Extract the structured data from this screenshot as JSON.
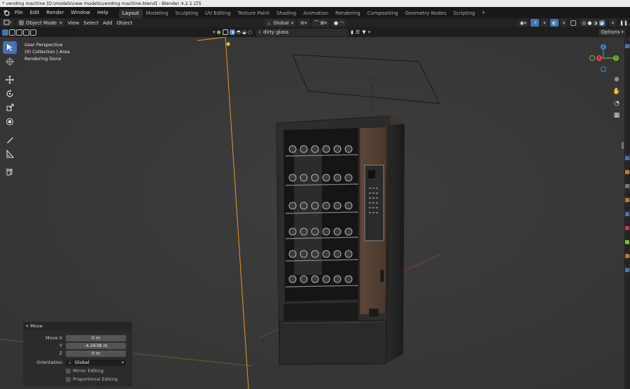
{
  "window": {
    "title": "* vending machine [D:\\models\\new models\\vending machine.blend] - Blender 4.2.1 LTS"
  },
  "menus": [
    "File",
    "Edit",
    "Render",
    "Window",
    "Help"
  ],
  "workspaces": [
    "Layout",
    "Modeling",
    "Sculpting",
    "UV Editing",
    "Texture Paint",
    "Shading",
    "Animation",
    "Rendering",
    "Compositing",
    "Geometry Nodes",
    "Scripting"
  ],
  "active_workspace": "Layout",
  "header": {
    "mode": "Object Mode",
    "view_menus": [
      "View",
      "Select",
      "Add",
      "Object"
    ],
    "transform_orientation": "Global",
    "material_search": "dirty glass",
    "options": "Options"
  },
  "viewport": {
    "info_lines": [
      "User Perspective",
      "(0) Collection | Area",
      "Rendering Done"
    ],
    "gizmo_axes": {
      "z": "Z",
      "y": "Y",
      "x": "X"
    }
  },
  "operator_panel": {
    "title": "Move",
    "rows": [
      {
        "label": "Move X",
        "value": "0 m"
      },
      {
        "label": "Y",
        "value": "-4.2638 m"
      },
      {
        "label": "Z",
        "value": "0 m"
      }
    ],
    "orientation_label": "Orientation",
    "orientation_value": "Global",
    "mirror_editing": "Mirror Editing",
    "proportional_editing": "Proportional Editing"
  },
  "colors": {
    "accent": "#4772b3",
    "axis_x": "#e8445b",
    "axis_y": "#6fba2c",
    "axis_z": "#3f88d9",
    "orange_outline": "#e8962c"
  }
}
